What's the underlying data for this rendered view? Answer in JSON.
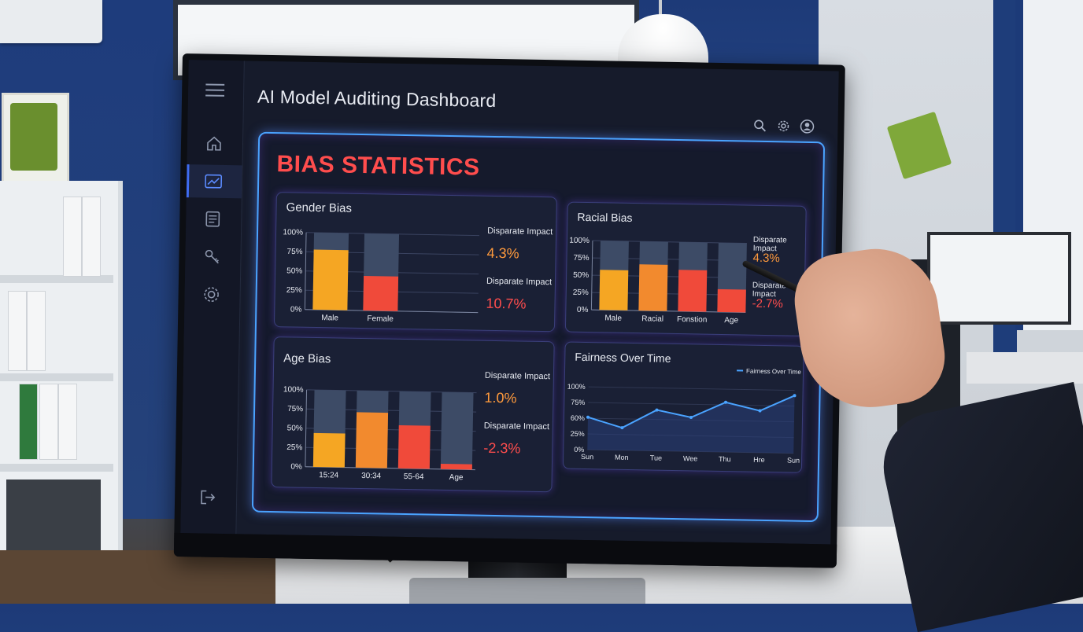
{
  "app": {
    "title": "AI Model Auditing Dashboard",
    "section_title": "BIAS STATISTICS"
  },
  "sidebar": {
    "items": [
      {
        "icon": "menu-icon"
      },
      {
        "icon": "home-icon"
      },
      {
        "icon": "analytics-icon",
        "active": true
      },
      {
        "icon": "document-icon"
      },
      {
        "icon": "key-icon"
      },
      {
        "icon": "settings-icon"
      },
      {
        "icon": "logout-icon"
      }
    ]
  },
  "header_icons": [
    "search-icon",
    "gear-icon",
    "user-icon"
  ],
  "colors": {
    "accent_blue": "#4aa3ff",
    "title_red": "#ff4d4d",
    "orange_value": "#ff9a3c",
    "red_value": "#ff4d4d",
    "bar_yellow": "#f5a623",
    "bar_orange": "#f28a2e",
    "bar_red": "#f04a3a",
    "bar_bg": "#3d4b66"
  },
  "cards": {
    "gender": {
      "title": "Gender Bias",
      "metrics": [
        {
          "label": "Disparate Impact",
          "value": "4.3%"
        },
        {
          "label": "Disparate Impact",
          "value": "10.7%"
        }
      ]
    },
    "racial": {
      "title": "Racial Bias",
      "metrics": [
        {
          "label": "Disparate Impact",
          "value": "4.3%"
        },
        {
          "label": "Disparate Impact",
          "value": "-2.7%"
        }
      ]
    },
    "age": {
      "title": "Age Bias",
      "metrics": [
        {
          "label": "Disparate Impact",
          "value": "1.0%"
        },
        {
          "label": "Disparate Impact",
          "value": "-2.3%"
        }
      ]
    },
    "fairness": {
      "title": "Fairness Over Time",
      "legend": "Fairness Over Time"
    }
  },
  "chart_data": [
    {
      "type": "bar",
      "title": "Gender Bias",
      "categories": [
        "Male",
        "Female"
      ],
      "values": [
        78,
        45
      ],
      "y_ticks": [
        "100%",
        "75%",
        "50%",
        "25%",
        "0%"
      ],
      "ylim": [
        0,
        100
      ],
      "bar_colors": [
        "#f5a623",
        "#f04a3a"
      ]
    },
    {
      "type": "bar",
      "title": "Racial Bias",
      "categories": [
        "Male",
        "Racial",
        "Fonstion",
        "Age"
      ],
      "values": [
        58,
        67,
        60,
        33
      ],
      "y_ticks": [
        "100%",
        "75%",
        "50%",
        "25%",
        "0%"
      ],
      "ylim": [
        0,
        100
      ],
      "bar_colors": [
        "#f5a623",
        "#f28a2e",
        "#f04a3a",
        "#f04a3a"
      ]
    },
    {
      "type": "bar",
      "title": "Age Bias",
      "categories": [
        "15:24",
        "30:34",
        "55-64",
        "Age"
      ],
      "values": [
        44,
        72,
        56,
        7
      ],
      "y_ticks": [
        "100%",
        "75%",
        "50%",
        "25%",
        "0%"
      ],
      "ylim": [
        0,
        100
      ],
      "bar_colors": [
        "#f5a623",
        "#f28a2e",
        "#f04a3a",
        "#f04a3a"
      ]
    },
    {
      "type": "area",
      "title": "Fairness Over Time",
      "categories": [
        "Sun",
        "Mon",
        "Tue",
        "Wee",
        "Thu",
        "Hre",
        "Sun"
      ],
      "series": [
        {
          "name": "Fairness Over Time",
          "values": [
            62,
            43,
            78,
            65,
            95,
            80,
            110
          ]
        }
      ],
      "y_ticks": [
        "100%",
        "75%",
        "60%",
        "25%",
        "0%"
      ],
      "ylim": [
        0,
        120
      ]
    }
  ]
}
